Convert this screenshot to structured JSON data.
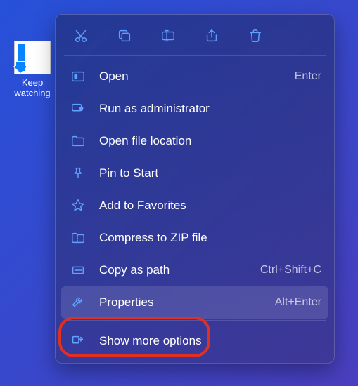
{
  "desktop_icon": {
    "label": "Keep watching"
  },
  "toolbar": {
    "cut": "cut",
    "copy": "copy",
    "rename": "rename",
    "share": "share",
    "delete": "delete"
  },
  "menu": {
    "open": {
      "label": "Open",
      "accel": "Enter"
    },
    "runadmin": {
      "label": "Run as administrator",
      "accel": ""
    },
    "openloc": {
      "label": "Open file location",
      "accel": ""
    },
    "pinstart": {
      "label": "Pin to Start",
      "accel": ""
    },
    "fav": {
      "label": "Add to Favorites",
      "accel": ""
    },
    "zip": {
      "label": "Compress to ZIP file",
      "accel": ""
    },
    "copypath": {
      "label": "Copy as path",
      "accel": "Ctrl+Shift+C"
    },
    "props": {
      "label": "Properties",
      "accel": "Alt+Enter"
    },
    "more": {
      "label": "Show more options",
      "accel": ""
    }
  }
}
